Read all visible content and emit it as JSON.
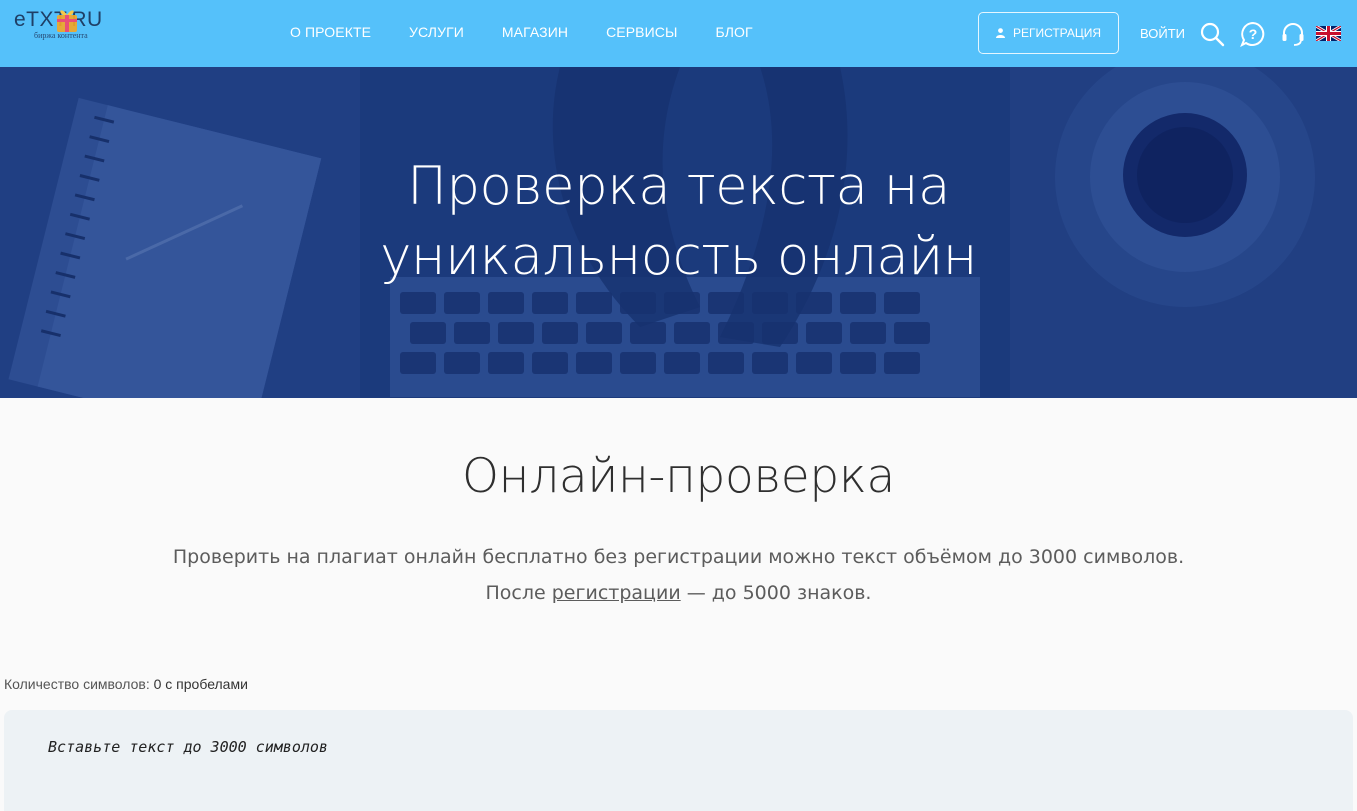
{
  "header": {
    "logo_text": "eTXT.RU",
    "logo_subtitle": "биржа контента",
    "nav": [
      "О ПРОЕКТЕ",
      "УСЛУГИ",
      "МАГАЗИН",
      "СЕРВИСЫ",
      "БЛОГ"
    ],
    "register_label": "РЕГИСТРАЦИЯ",
    "login_label": "ВОЙТИ"
  },
  "hero": {
    "title_line1": "Проверка текста на",
    "title_line2": "уникальность онлайн"
  },
  "main": {
    "title": "Онлайн-проверка",
    "desc_line1": "Проверить на плагиат онлайн бесплатно без регистрации можно текст объёмом до 3000 символов.",
    "desc_line2_before": "После ",
    "desc_link": "регистрации",
    "desc_line2_after": " — до 5000 знаков.",
    "count_label": "Количество символов:",
    "count_value": "0 с пробелами",
    "textarea_placeholder": "Вставьте текст до 3000 символов"
  },
  "colors": {
    "header_bg": "#55c1fa",
    "hero_bg": "#1e3e80",
    "page_bg": "#fafafa",
    "textarea_bg": "#edf2f5"
  },
  "icons": [
    "user-icon",
    "search-icon",
    "help-icon",
    "headset-icon",
    "uk-flag-icon",
    "logo-gift-icon"
  ]
}
